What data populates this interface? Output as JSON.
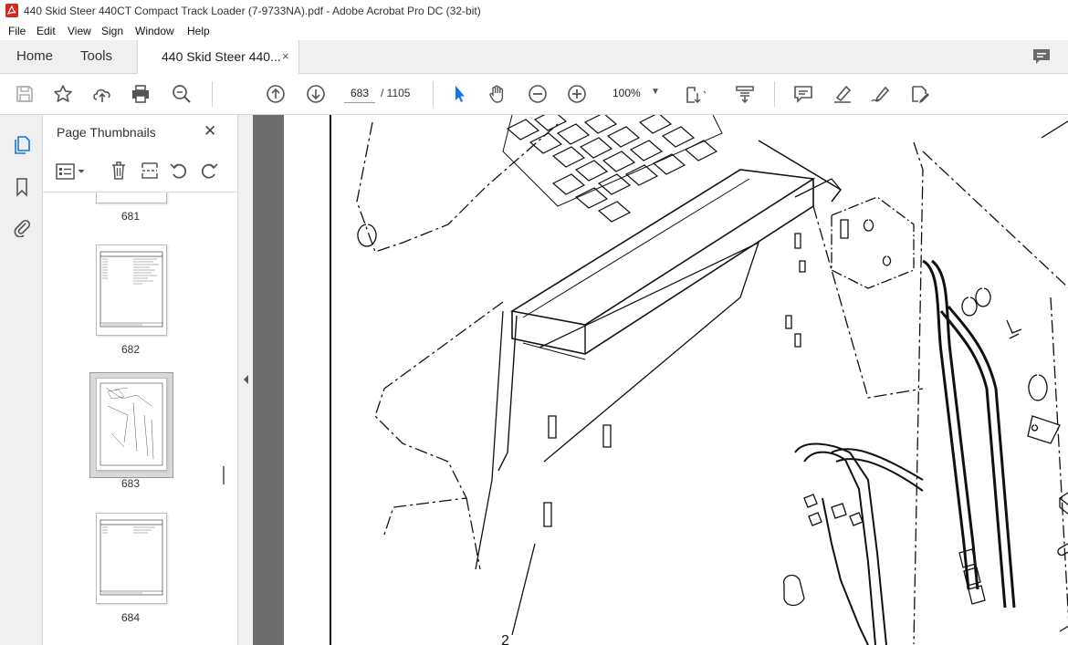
{
  "window": {
    "title": "440 Skid Steer 440CT Compact Track Loader (7-9733NA).pdf - Adobe Acrobat Pro DC (32-bit)"
  },
  "menu": {
    "items": [
      "File",
      "Edit",
      "View",
      "Sign",
      "Window",
      "Help"
    ]
  },
  "tabs": {
    "home": "Home",
    "tools": "Tools",
    "document": "440 Skid Steer 440...",
    "close": "×"
  },
  "toolbar": {
    "current_page": "683",
    "page_total": "/  1105",
    "zoom": "100%",
    "icons": [
      "save-icon",
      "star-icon",
      "upload-icon",
      "print-icon",
      "search-zoom-icon",
      "arrow-up-icon",
      "arrow-down-icon",
      "select-cursor-icon",
      "hand-icon",
      "zoom-out-icon",
      "zoom-in-icon",
      "fit-page-icon",
      "scroll-mode-icon",
      "comment-icon",
      "highlight-icon",
      "sign-icon",
      "edit-icon"
    ]
  },
  "left_rail": {
    "icons": [
      "page-thumbnails-icon",
      "bookmark-icon",
      "attachment-icon"
    ]
  },
  "thumbnail_panel": {
    "title": "Page Thumbnails",
    "close": "✕",
    "pages": [
      {
        "number": "681",
        "selected": false
      },
      {
        "number": "682",
        "selected": false
      },
      {
        "number": "683",
        "selected": true
      },
      {
        "number": "684",
        "selected": false
      }
    ]
  },
  "document": {
    "callout": "2"
  },
  "colors": {
    "accent": "#1473e6",
    "chrome": "#f0f0f0",
    "doc_bg": "#6d6d6d",
    "acrobat_red": "#d7281e"
  }
}
